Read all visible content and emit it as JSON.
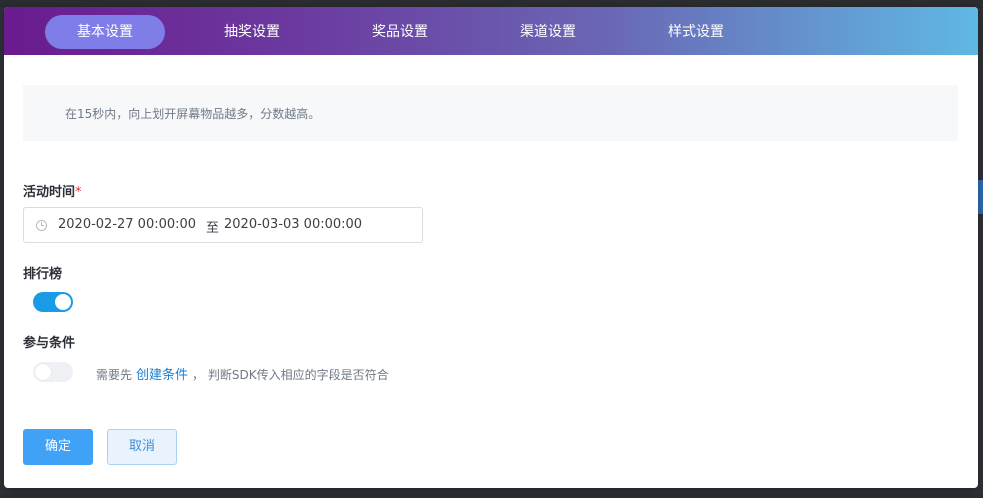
{
  "tabs": [
    {
      "label": "基本设置",
      "active": true
    },
    {
      "label": "抽奖设置",
      "active": false
    },
    {
      "label": "奖品设置",
      "active": false
    },
    {
      "label": "渠道设置",
      "active": false
    },
    {
      "label": "样式设置",
      "active": false
    }
  ],
  "notice": "在15秒内，向上划开屏幕物品越多，分数越高。",
  "activity_time": {
    "label": "活动时间",
    "required_mark": "*",
    "start": "2020-02-27 00:00:00",
    "separator": "至",
    "end": "2020-03-03 00:00:00"
  },
  "leaderboard": {
    "label": "排行榜",
    "enabled": true
  },
  "participation": {
    "label": "参与条件",
    "enabled": false,
    "hint_prefix": "需要先",
    "link": "创建条件",
    "hint_suffix": "，  判断SDK传入相应的字段是否符合"
  },
  "actions": {
    "confirm": "确定",
    "cancel": "取消"
  },
  "colors": {
    "primary": "#3fa2f7",
    "switch_on": "#1a9be6",
    "active_tab": "#7f7de8",
    "required": "#e03b3b"
  }
}
